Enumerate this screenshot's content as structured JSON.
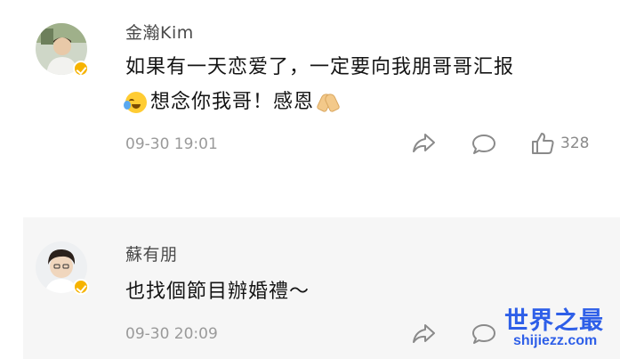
{
  "comments": [
    {
      "username": "金瀚Kim",
      "text_line1": "如果有一天恋爱了，一定要向我朋哥哥汇报",
      "text_line2": "想念你我哥！感恩",
      "timestamp": "09-30 19:01",
      "like_count": "328"
    },
    {
      "username": "蘇有朋",
      "text": "也找個節目辦婚禮～",
      "timestamp": "09-30 20:09"
    }
  ],
  "watermark": {
    "title": "世界之最",
    "url": "shijiezz.com"
  },
  "icons": {
    "share": "share-icon",
    "comment": "comment-icon",
    "like": "thumbs-up-icon",
    "verified": "verified-badge-icon",
    "cry": "crying-emoji-icon",
    "pray": "praying-hands-emoji-icon"
  },
  "colors": {
    "accent_verified": "#f6b300",
    "watermark": "#2e5fe8",
    "meta_text": "#9a9a9a"
  }
}
